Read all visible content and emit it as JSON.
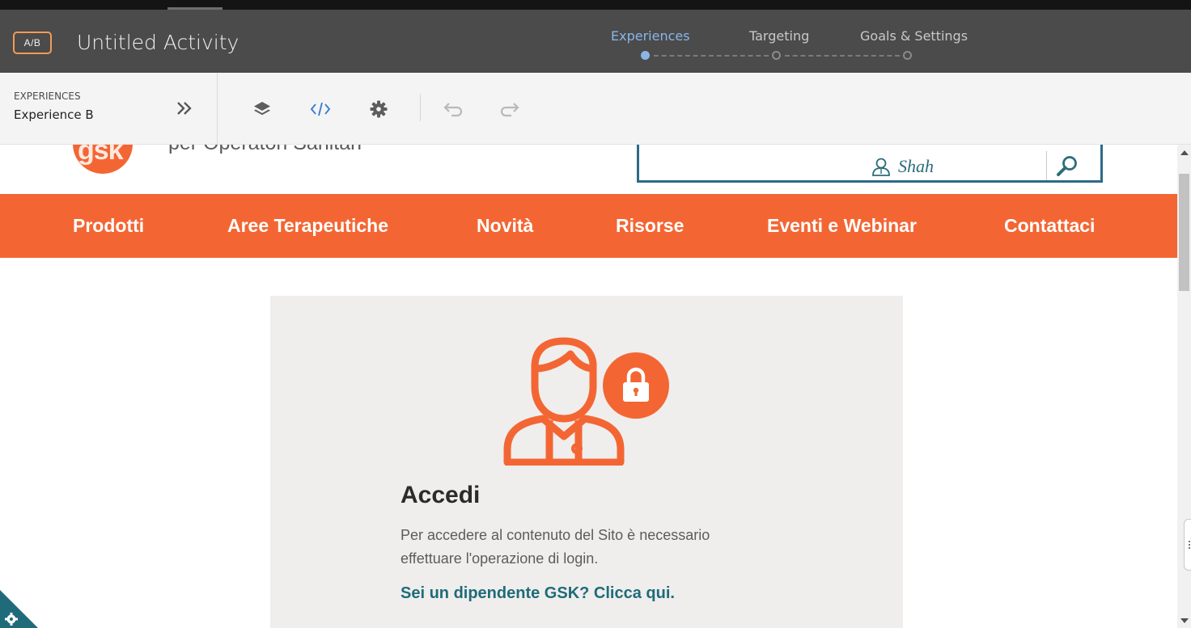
{
  "header": {
    "badge": "A/B",
    "title": "Untitled Activity",
    "steps": [
      {
        "label": "Experiences",
        "active": true
      },
      {
        "label": "Targeting",
        "active": false
      },
      {
        "label": "Goals & Settings",
        "active": false
      }
    ],
    "active_color": "#8ab6e6"
  },
  "toolbar": {
    "experiences_label": "EXPERIENCES",
    "experience_value": "Experience B",
    "icons": [
      "collapse-chevrons-icon",
      "layers-icon",
      "code-icon",
      "gear-icon",
      "undo-icon",
      "redo-icon"
    ]
  },
  "site": {
    "tagline": "per Operatori Sanitari",
    "search": {
      "user_name": "Shah"
    },
    "nav": [
      "Prodotti",
      "Aree Terapeutiche",
      "Novità",
      "Risorse",
      "Eventi e Webinar",
      "Contattaci"
    ],
    "brand_color": "#f36633",
    "login_card": {
      "title": "Accedi",
      "body": "Per accedere al contenuto del Sito è necessario effettuare l'operazione di login.",
      "link": "Sei un dipendente GSK? Clicca qui."
    }
  }
}
